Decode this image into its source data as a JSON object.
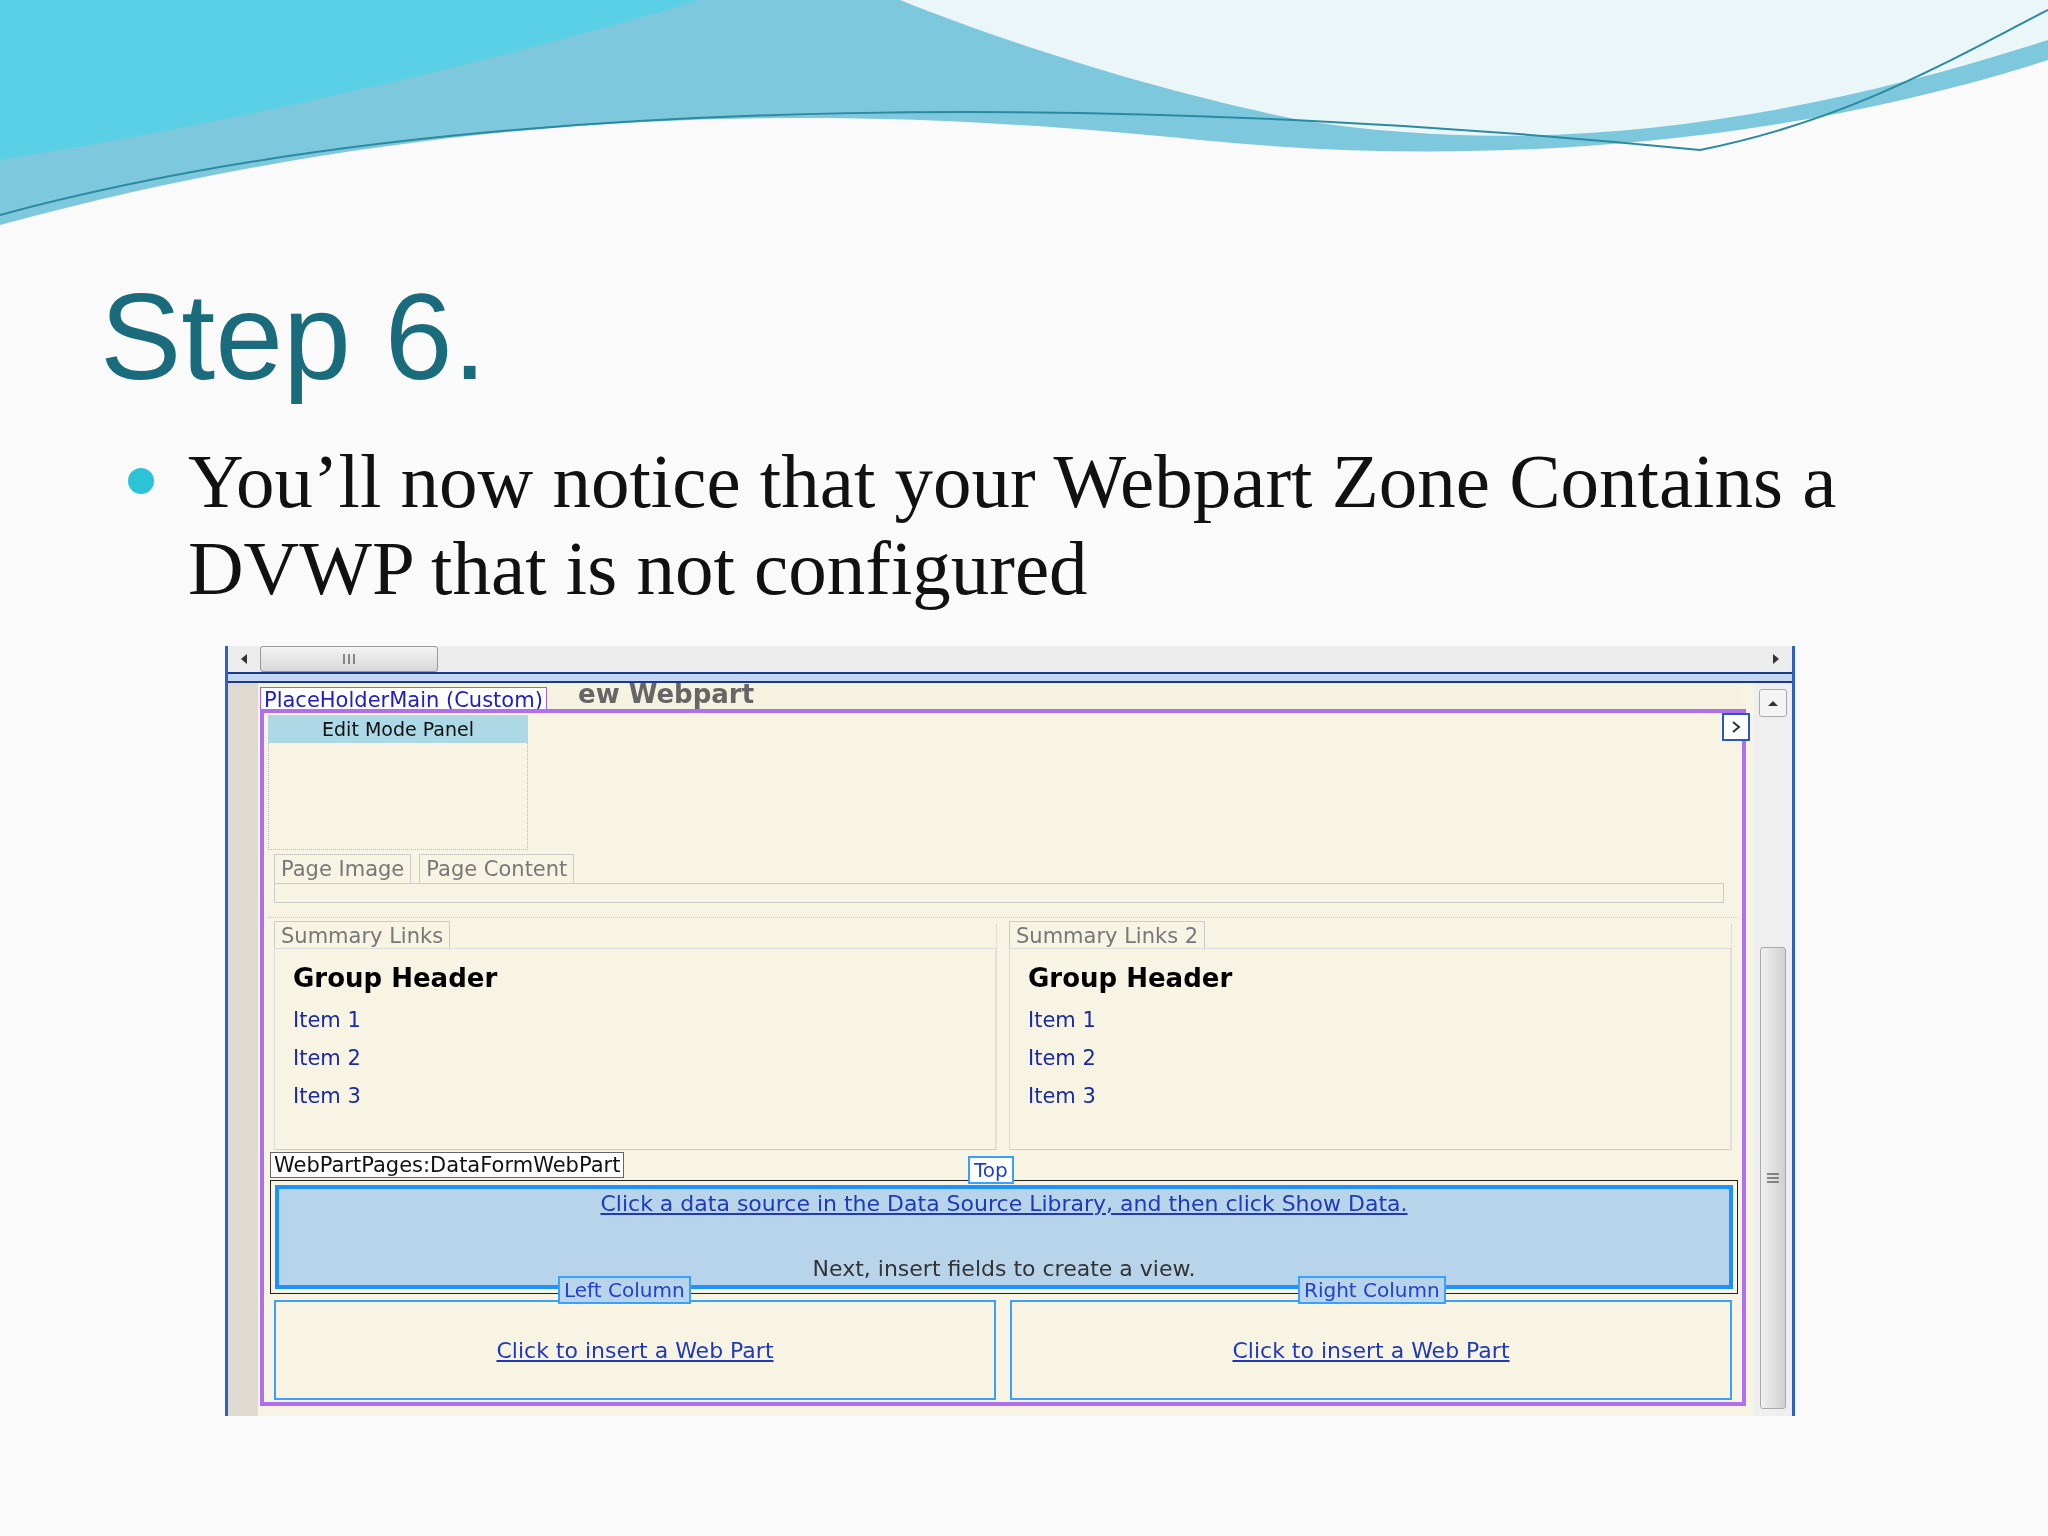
{
  "slide": {
    "title": "Step 6.",
    "bullet": "You’ll now notice that your Webpart Zone Contains a DVWP that is not configured"
  },
  "designer": {
    "partial_title": "ew Webpart",
    "placeholder_tag": "PlaceHolderMain (Custom)",
    "edit_panel": "Edit Mode Panel",
    "page_tabs": [
      "Page Image",
      "Page Content"
    ],
    "summary_columns": [
      {
        "tab": "Summary Links",
        "group_header": "Group Header",
        "items": [
          "Item 1",
          "Item 2",
          "Item 3"
        ]
      },
      {
        "tab": "Summary Links 2",
        "group_header": "Group Header",
        "items": [
          "Item 1",
          "Item 2",
          "Item 3"
        ]
      }
    ],
    "dataform_tag": "WebPartPages:DataFormWebPart",
    "top_tag": "Top",
    "dataform_link": "Click a data source in the Data Source Library, and then click Show Data.",
    "dataform_hint": "Next, insert fields to create a view.",
    "zones": [
      {
        "tag": "Left Column",
        "link": "Click to insert a Web Part"
      },
      {
        "tag": "Right Column",
        "link": "Click to insert a Web Part"
      }
    ]
  }
}
